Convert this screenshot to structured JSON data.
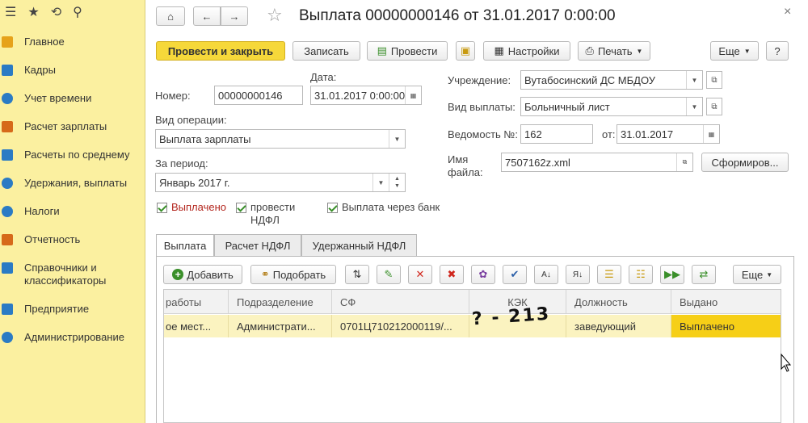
{
  "sidebar": {
    "items": [
      {
        "label": "Главное",
        "color": "#e6a21a"
      },
      {
        "label": "Кадры",
        "color": "#2b7bc4"
      },
      {
        "label": "Учет времени",
        "color": "#2b7bc4"
      },
      {
        "label": "Расчет зарплаты",
        "color": "#d66a1a"
      },
      {
        "label": "Расчеты по среднему",
        "color": "#2b7bc4"
      },
      {
        "label": "Удержания, выплаты",
        "color": "#2b7bc4"
      },
      {
        "label": "Налоги",
        "color": "#2b7bc4"
      },
      {
        "label": "Отчетность",
        "color": "#d66a1a"
      },
      {
        "label": "Справочники и классификаторы",
        "color": "#2b7bc4"
      },
      {
        "label": "Предприятие",
        "color": "#2b7bc4"
      },
      {
        "label": "Администрирование",
        "color": "#2b7bc4"
      }
    ]
  },
  "window": {
    "title": "Выплата 00000000146 от 31.01.2017 0:00:00",
    "close_glyph": "×"
  },
  "toolbar": {
    "post_close": "Провести и закрыть",
    "save": "Записать",
    "post": "Провести",
    "settings": "Настройки",
    "print": "Печать",
    "more": "Еще",
    "help": "?"
  },
  "form": {
    "number_label": "Номер:",
    "number_value": "00000000146",
    "date_label": "Дата:",
    "date_value": "31.01.2017  0:00:00",
    "operation_label": "Вид операции:",
    "operation_value": "Выплата зарплаты",
    "period_label": "За период:",
    "period_value": "Январь 2017 г.",
    "institution_label": "Учреждение:",
    "institution_value": "Вутабосинский ДС МБДОУ",
    "payment_type_label": "Вид выплаты:",
    "payment_type_value": "Больничный лист",
    "statement_label": "Ведомость №:",
    "statement_value": "162",
    "from_label": "от:",
    "from_value": "31.01.2017",
    "file_label": "Имя файла:",
    "file_value": "7507162z.xml",
    "generate_button": "Сформиров...",
    "chk_paid": "Выплачено",
    "chk_ndfl": "провести НДФЛ",
    "chk_bank": "Выплата через банк"
  },
  "tabs": [
    "Выплата",
    "Расчет НДФЛ",
    "Удержанный НДФЛ"
  ],
  "table_toolbar": {
    "add": "Добавить",
    "pick": "Подобрать",
    "more": "Еще"
  },
  "table": {
    "columns": [
      "работы",
      "Подразделение",
      "СФ",
      "КЭК",
      "Должность",
      "Выдано"
    ],
    "rows": [
      [
        "ое мест...",
        "Администрати...",
        "0701Ц710212000119/...",
        "",
        "заведующий",
        "Выплачено"
      ]
    ]
  },
  "annotation": {
    "text": "? - 213"
  }
}
